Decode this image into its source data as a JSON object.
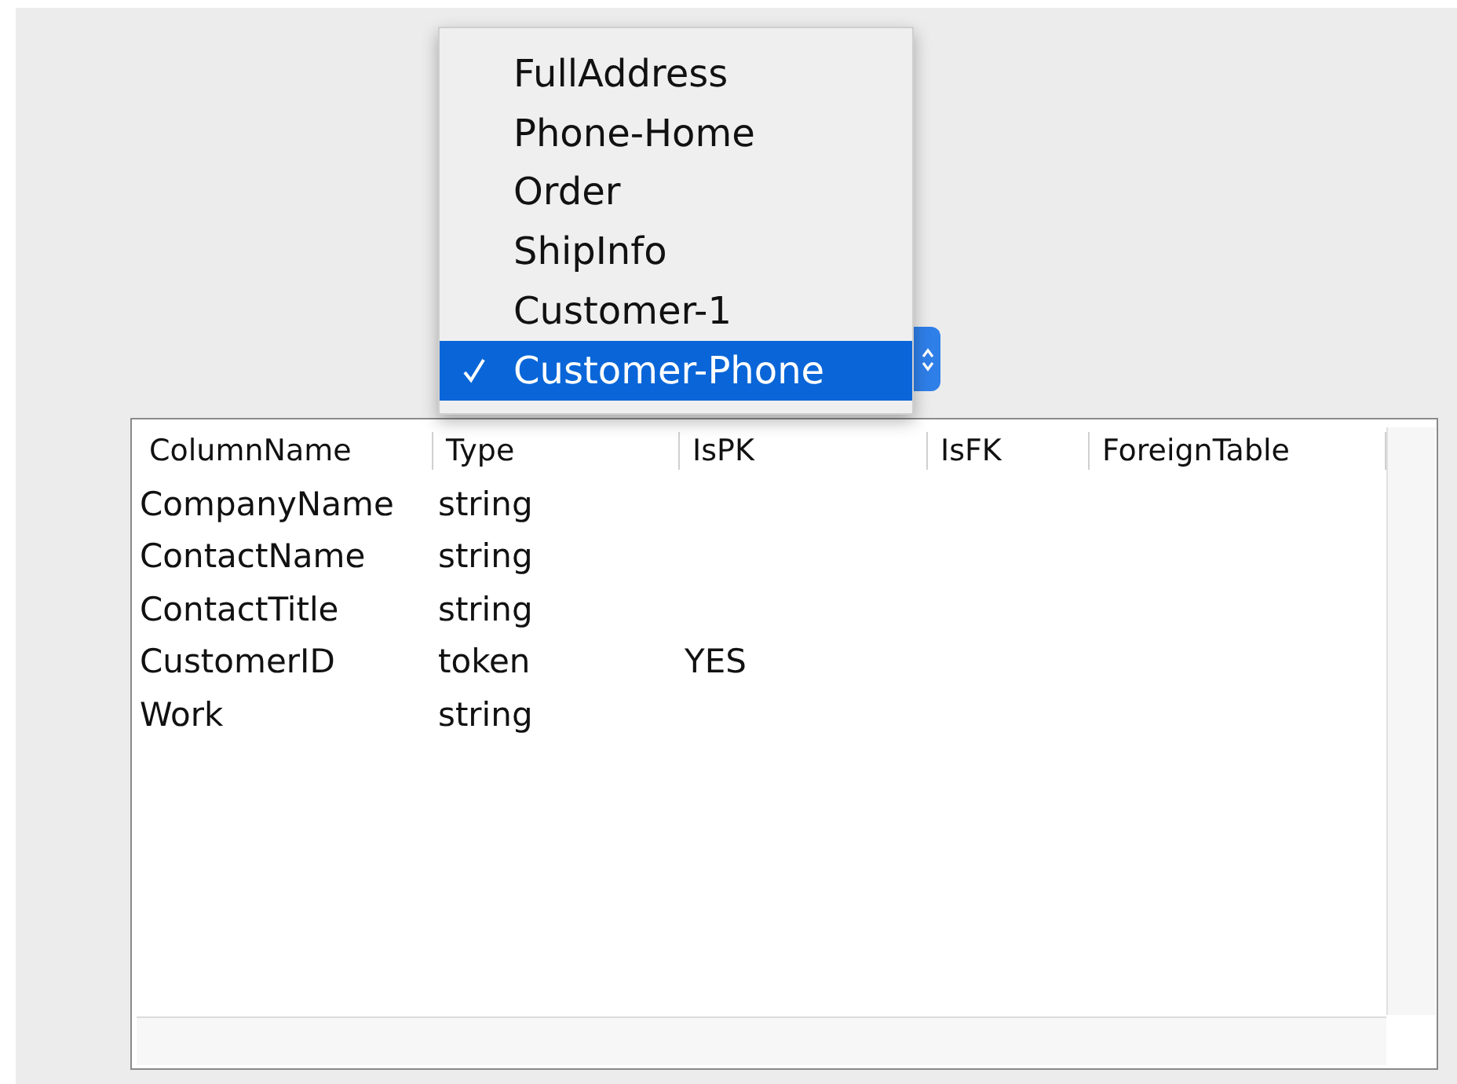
{
  "dropdown_menu": {
    "items": [
      {
        "label": "FullAddress",
        "selected": false
      },
      {
        "label": "Phone-Home",
        "selected": false
      },
      {
        "label": "Order",
        "selected": false
      },
      {
        "label": "ShipInfo",
        "selected": false
      },
      {
        "label": "Customer-1",
        "selected": false
      },
      {
        "label": "Customer-Phone",
        "selected": true
      }
    ]
  },
  "table": {
    "columns": [
      "ColumnName",
      "Type",
      "IsPK",
      "IsFK",
      "ForeignTable"
    ],
    "rows": [
      [
        "CompanyName",
        "string",
        "",
        "",
        ""
      ],
      [
        "ContactName",
        "string",
        "",
        "",
        ""
      ],
      [
        "ContactTitle",
        "string",
        "",
        "",
        ""
      ],
      [
        "CustomerID",
        "token",
        "YES",
        "",
        ""
      ],
      [
        "Work",
        "string",
        "",
        "",
        ""
      ]
    ]
  }
}
